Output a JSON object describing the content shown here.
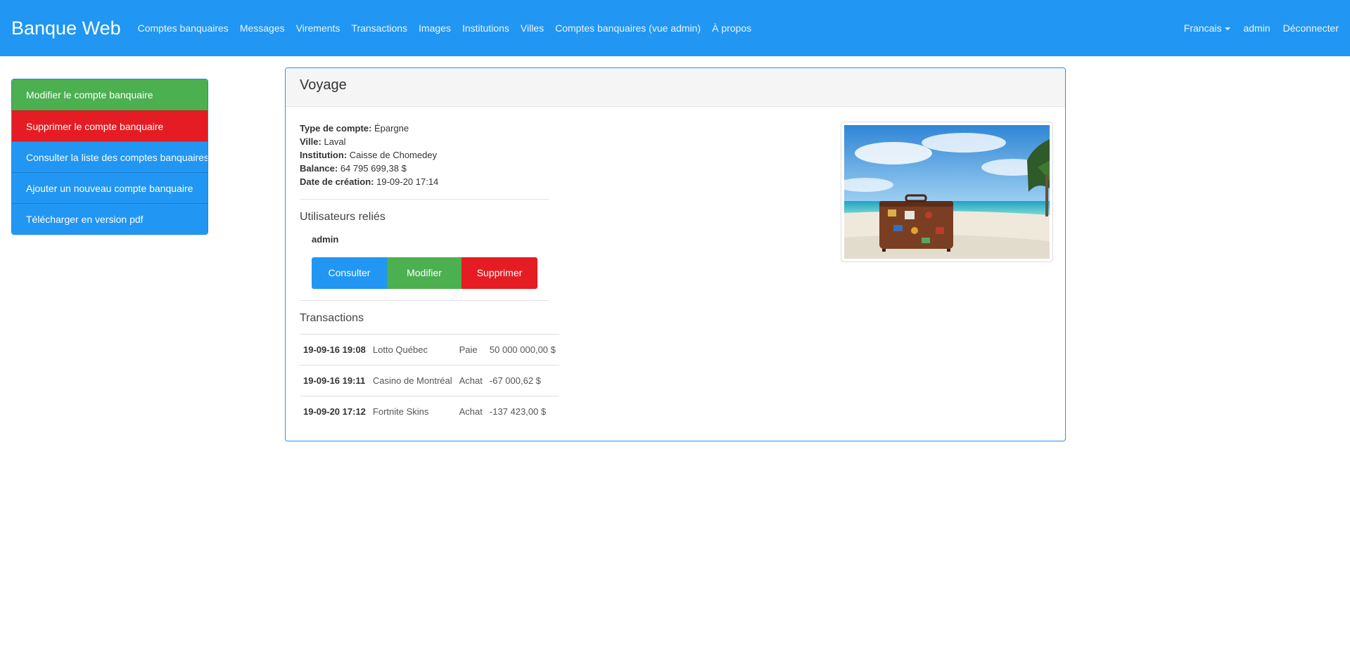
{
  "navbar": {
    "brand": "Banque Web",
    "links": [
      "Comptes banquaires",
      "Messages",
      "Virements",
      "Transactions",
      "Images",
      "Institutions",
      "Villes",
      "Comptes banquaires (vue admin)",
      "À propos"
    ],
    "language": "Francais",
    "user": "admin",
    "logout": "Déconnecter"
  },
  "sidebar": {
    "items": [
      {
        "label": "Modifier le compte banquaire",
        "color": "#4caf50"
      },
      {
        "label": "Supprimer le compte banquaire",
        "color": "#e51c23"
      },
      {
        "label": "Consulter la liste des comptes banquaires",
        "color": "#2196f3"
      },
      {
        "label": "Ajouter un nouveau compte banquaire",
        "color": "#2196f3"
      },
      {
        "label": "Télécharger en version pdf",
        "color": "#2196f3"
      }
    ]
  },
  "account": {
    "title": "Voyage",
    "fields": [
      {
        "label": "Type de compte:",
        "value": "Épargne"
      },
      {
        "label": "Ville:",
        "value": "Laval"
      },
      {
        "label": "Institution:",
        "value": "Caisse de Chomedey"
      },
      {
        "label": "Balance:",
        "value": "64 795 699,38 $"
      },
      {
        "label": "Date de création:",
        "value": "19-09-20 17:14"
      }
    ],
    "users_heading": "Utilisateurs reliés",
    "users": [
      {
        "name": "admin",
        "buttons": {
          "view": "Consulter",
          "edit": "Modifier",
          "delete": "Supprimer"
        }
      }
    ],
    "transactions_heading": "Transactions",
    "transactions": [
      {
        "date": "19-09-16 19:08",
        "party": "Lotto Québec",
        "type": "Paie",
        "amount": "50 000 000,00 $"
      },
      {
        "date": "19-09-16 19:11",
        "party": "Casino de Montréal",
        "type": "Achat",
        "amount": "-67 000,62 $"
      },
      {
        "date": "19-09-20 17:12",
        "party": "Fortnite Skins",
        "type": "Achat",
        "amount": "-137 423,00 $"
      }
    ],
    "image_icon": "suitcase-beach-photo"
  },
  "colors": {
    "primary": "#2196f3",
    "success": "#4caf50",
    "danger": "#e51c23"
  }
}
